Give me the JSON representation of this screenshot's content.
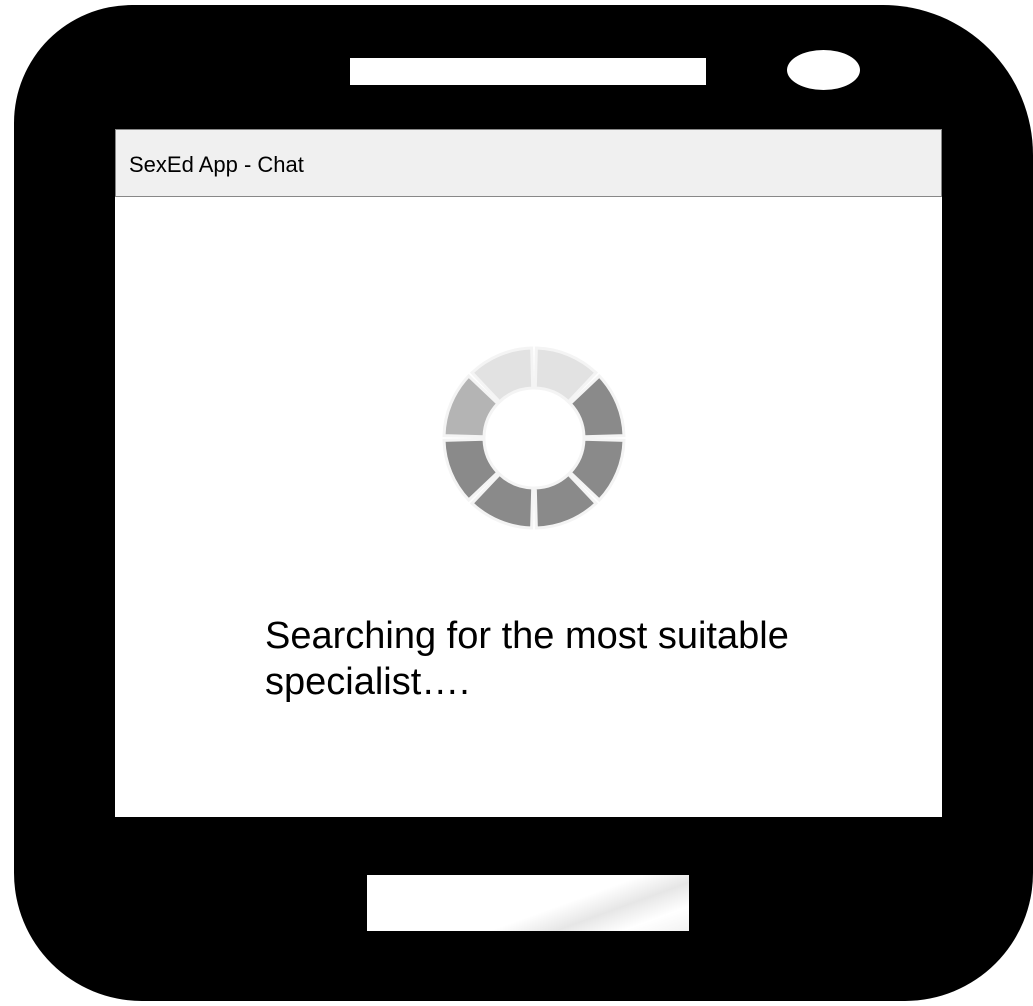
{
  "app": {
    "title": "SexEd App - Chat"
  },
  "status": {
    "message": "Searching for the most suitable specialist…."
  },
  "icons": {
    "spinner": "loading-spinner-icon"
  },
  "colors": {
    "device_body": "#000000",
    "screen_background": "#ffffff",
    "title_bar": "#f0f0f0",
    "spinner_dark": "#8a8a8a",
    "spinner_mid": "#b4b4b4",
    "spinner_light": "#e2e2e2"
  }
}
